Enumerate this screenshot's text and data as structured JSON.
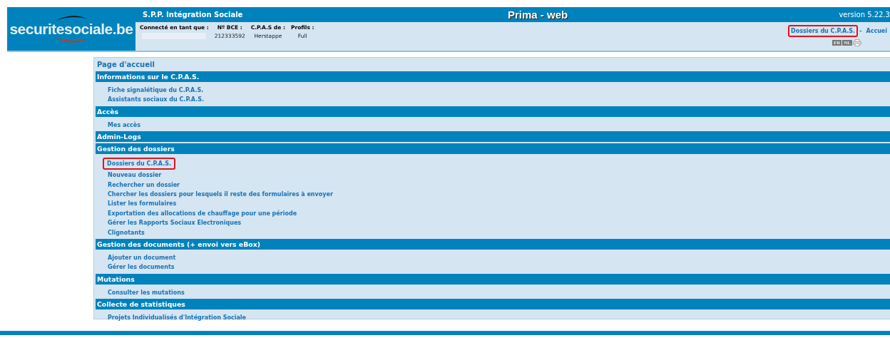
{
  "header": {
    "logo": "securitesociale.be",
    "organization": "S.P.P. Intégration Sociale",
    "app_title": "Prima - web",
    "version": "version 5.22.3",
    "user_info": [
      {
        "kind": "redacted",
        "label": "Connecté en tant que :"
      },
      {
        "kind": "value",
        "label": "Nº BCE :",
        "value": "212333592"
      },
      {
        "kind": "value",
        "label": "C.P.A.S de :",
        "value": "Herstappe"
      },
      {
        "kind": "value",
        "label": "Profils :",
        "value": "Full"
      }
    ],
    "breadcrumb": [
      {
        "label": "Dossiers du C.P.A.S.",
        "highlighted": true
      },
      {
        "label": "Accuei",
        "highlighted": false
      }
    ],
    "breadcrumb_separator": "-",
    "languages": [
      {
        "label": "FR"
      },
      {
        "label": "NL"
      }
    ]
  },
  "page_title": "Page d'accueil",
  "sections": [
    {
      "title": "Informations sur le C.P.A.S.",
      "links": [
        {
          "label": "Fiche signalétique du C.P.A.S.",
          "highlighted": false
        },
        {
          "label": "Assistants sociaux du C.P.A.S.",
          "highlighted": false
        }
      ]
    },
    {
      "title": "Accès",
      "links": [
        {
          "label": "Mes accès",
          "highlighted": false
        }
      ]
    },
    {
      "title": "Admin-Logs"
    },
    {
      "title": "Gestion des dossiers",
      "links": [
        {
          "label": "Dossiers du C.P.A.S.",
          "highlighted": true
        },
        {
          "label": "Nouveau dossier",
          "highlighted": false
        },
        {
          "label": "Rechercher un dossier",
          "highlighted": false
        },
        {
          "label": "Chercher les dossiers pour lesquels il reste des formulaires à envoyer",
          "highlighted": false
        },
        {
          "label": "Lister les formulaires",
          "highlighted": false
        },
        {
          "label": "Exportation des allocations de chauffage pour une période",
          "highlighted": false
        },
        {
          "label": "Gérer les Rapports Sociaux Electroniques",
          "highlighted": false
        },
        {
          "label": "Clignotants",
          "highlighted": false
        }
      ]
    },
    {
      "title": "Gestion des documents (+ envoi vers eBox)",
      "links": [
        {
          "label": "Ajouter un document",
          "highlighted": false
        },
        {
          "label": "Gérer les documents",
          "highlighted": false
        }
      ]
    },
    {
      "title": "Mutations",
      "links": [
        {
          "label": "Consulter les mutations",
          "highlighted": false
        }
      ]
    },
    {
      "title": "Collecte de statistiques",
      "links": [
        {
          "label": "Projets Individualisés d'Intégration Sociale",
          "highlighted": false
        }
      ]
    }
  ]
}
